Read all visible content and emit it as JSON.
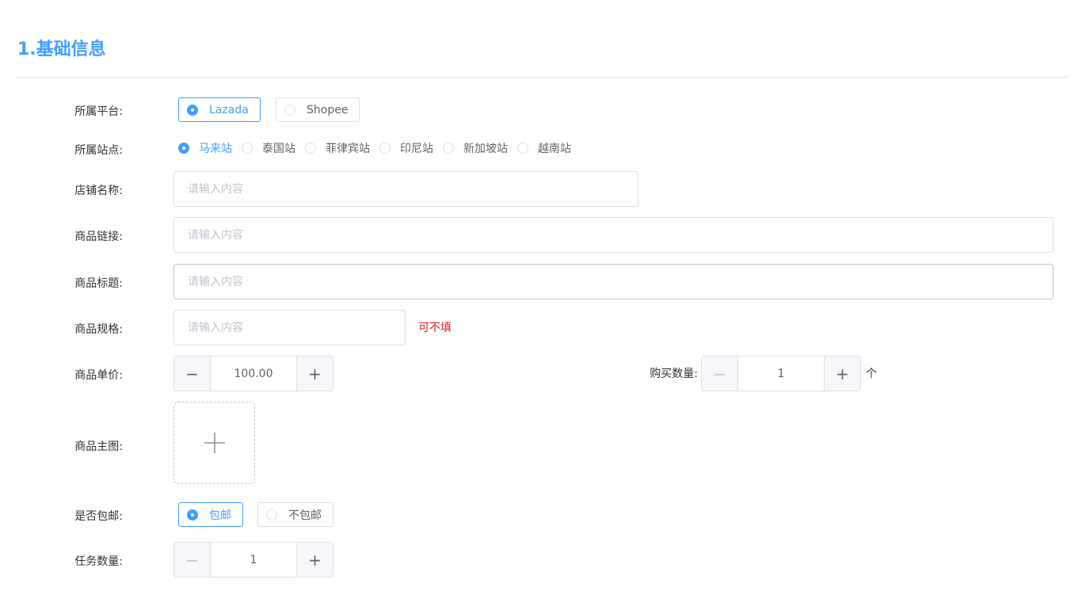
{
  "section": {
    "title": "1.基础信息"
  },
  "platform": {
    "label": "所属平台:",
    "options": [
      {
        "label": "Lazada",
        "selected": true
      },
      {
        "label": "Shopee",
        "selected": false
      }
    ]
  },
  "site": {
    "label": "所属站点:",
    "options": [
      {
        "label": "马来站",
        "selected": true
      },
      {
        "label": "泰国站",
        "selected": false
      },
      {
        "label": "菲律宾站",
        "selected": false
      },
      {
        "label": "印尼站",
        "selected": false
      },
      {
        "label": "新加坡站",
        "selected": false
      },
      {
        "label": "越南站",
        "selected": false
      }
    ]
  },
  "shop_name": {
    "label": "店铺名称:",
    "placeholder": "请输入内容",
    "value": ""
  },
  "product_link": {
    "label": "商品链接:",
    "placeholder": "请输入内容",
    "value": ""
  },
  "product_title": {
    "label": "商品标题:",
    "placeholder": "请输入内容",
    "value": ""
  },
  "product_spec": {
    "label": "商品规格:",
    "placeholder": "请输入内容",
    "value": "",
    "hint": "可不填"
  },
  "unit_price": {
    "label": "商品单价:",
    "value": "100.00",
    "dec_icon": "minus-icon",
    "inc_icon": "plus-icon"
  },
  "purchase_qty": {
    "label": "购买数量:",
    "value": "1",
    "unit": "个",
    "dec_icon": "minus-icon",
    "inc_icon": "plus-icon"
  },
  "main_image": {
    "label": "商品主图:",
    "icon": "plus-icon"
  },
  "free_shipping": {
    "label": "是否包邮:",
    "options": [
      {
        "label": "包邮",
        "selected": true
      },
      {
        "label": "不包邮",
        "selected": false
      }
    ]
  },
  "task_qty": {
    "label": "任务数量:",
    "value": "1",
    "dec_icon": "minus-icon",
    "inc_icon": "plus-icon"
  },
  "colors": {
    "primary": "#409eff",
    "hint": "#e02020",
    "border": "#dcdfe6"
  }
}
